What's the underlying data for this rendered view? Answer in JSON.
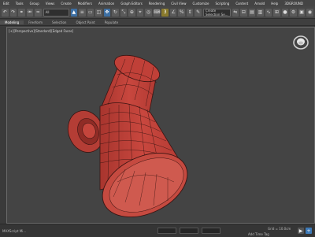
{
  "menubar": {
    "items": [
      "Edit",
      "Tools",
      "Group",
      "Views",
      "Create",
      "Modifiers",
      "Animation",
      "Graph Editors",
      "Rendering",
      "Civil View",
      "Customize",
      "Scripting",
      "Content",
      "Arnold",
      "Help",
      "3DGROUND"
    ]
  },
  "toolbar": {
    "selection_filter": "All",
    "named_selection": "Create Selection Se..."
  },
  "ribbon": {
    "tabs": [
      "Modeling",
      "Freeform",
      "Selection",
      "Object Paint",
      "Populate"
    ]
  },
  "viewport": {
    "label": "[+][Perspective][Standard][Edged Faces]"
  },
  "statusbar": {
    "maxscript": "MAXScript Mi...",
    "grid": "Grid = 10.0cm",
    "add_time_tag": "Add Time Tag"
  },
  "colors": {
    "mesh_fill": "#c0433b",
    "mesh_wire": "#3a1412",
    "viewport_bg": "#444444"
  }
}
